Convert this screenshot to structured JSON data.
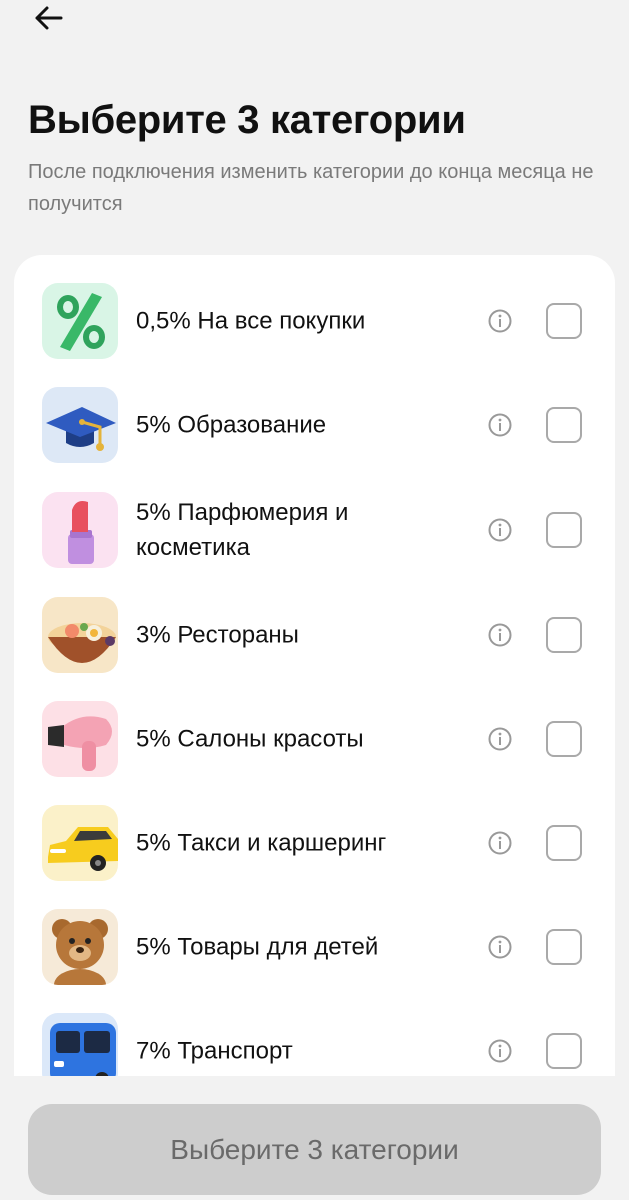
{
  "header": {
    "back_icon": "arrow-left-icon",
    "title": "Выберите 3 категории",
    "subtitle": "После подключения изменить категории до конца месяца не получится"
  },
  "categories": [
    {
      "label": "0,5% На все покупки",
      "icon": "percent-icon",
      "checked": false
    },
    {
      "label": "5% Образование",
      "icon": "graduation-cap-icon",
      "checked": false
    },
    {
      "label": "5% Парфюмерия и косметика",
      "icon": "lipstick-icon",
      "checked": false
    },
    {
      "label": "3% Рестораны",
      "icon": "food-bowl-icon",
      "checked": false
    },
    {
      "label": "5% Салоны красоты",
      "icon": "hair-dryer-icon",
      "checked": false
    },
    {
      "label": "5% Такси и каршеринг",
      "icon": "taxi-car-icon",
      "checked": false
    },
    {
      "label": "5% Товары для детей",
      "icon": "teddy-bear-icon",
      "checked": false
    },
    {
      "label": "7% Транспорт",
      "icon": "bus-icon",
      "checked": false
    }
  ],
  "footer": {
    "button_label": "Выберите 3 категории",
    "button_enabled": false
  },
  "colors": {
    "background": "#f2f2f2",
    "card": "#ffffff",
    "button_disabled": "#cdcdcd",
    "subtitle": "#7a7a7a"
  }
}
